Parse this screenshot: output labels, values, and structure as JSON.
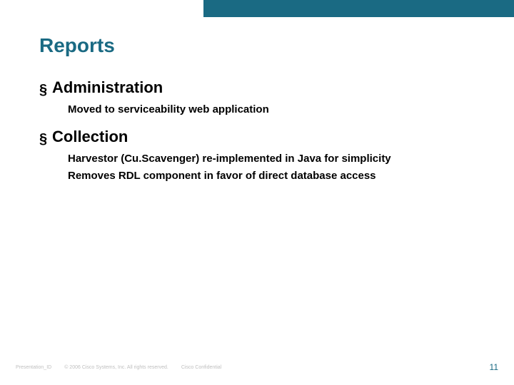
{
  "title": "Reports",
  "sections": {
    "s0": {
      "heading": "Administration",
      "lines": {
        "l0": "Moved to serviceability web application"
      }
    },
    "s1": {
      "heading": "Collection",
      "lines": {
        "l0": "Harvestor (Cu.Scavenger) re-implemented in Java for simplicity",
        "l1": "Removes RDL component in favor of direct database access"
      }
    }
  },
  "footer": {
    "id": "Presentation_ID",
    "copyright": "© 2006 Cisco Systems, Inc. All rights reserved.",
    "confidential": "Cisco Confidential",
    "page": "11"
  }
}
